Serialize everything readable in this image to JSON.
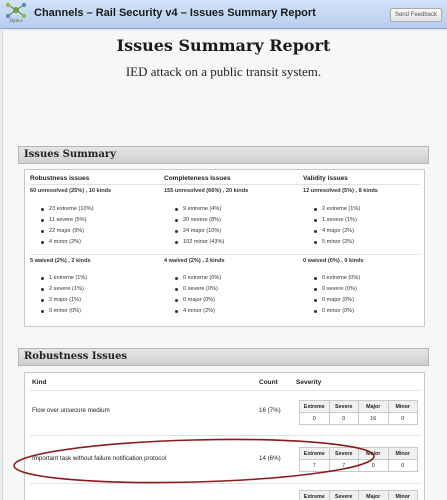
{
  "header": {
    "logo_text": "Hpie.e",
    "title": "Channels – Rail Security v4 – Issues Summary Report",
    "feedback_label": "Send Feedback"
  },
  "report": {
    "title": "Issues Summary Report",
    "subtitle": "IED attack on a public transit system."
  },
  "summary": {
    "heading": "Issues Summary",
    "columns": [
      {
        "header": "Robustness issues",
        "unresolved": "60 unresolved (25%) , 10 kinds",
        "unresolved_items": [
          "23 extreme (10%)",
          "11 severe (5%)",
          "22 major (9%)",
          "4 minor (2%)"
        ],
        "waived": "5 waived (2%) , 2 kinds",
        "waived_items": [
          "1 extreme (1%)",
          "2 severe (1%)",
          "2 major (1%)",
          "0 minor (0%)"
        ]
      },
      {
        "header": "Completeness Issues",
        "unresolved": "155 unresolved (66%) , 20 kinds",
        "unresolved_items": [
          "9 extreme (4%)",
          "20 severe (8%)",
          "24 major (10%)",
          "102 minor (43%)"
        ],
        "waived": "4 waived (2%) , 2 kinds",
        "waived_items": [
          "0 extreme (0%)",
          "0 severe (0%)",
          "0 major (0%)",
          "4 minor (2%)"
        ]
      },
      {
        "header": "Validity issues",
        "unresolved": "12 unresolved (5%) , 8 kinds",
        "unresolved_items": [
          "2 extreme (1%)",
          "1 severe (1%)",
          "4 major (2%)",
          "5 minor (2%)"
        ],
        "waived": "0 waived (0%) , 0 kinds",
        "waived_items": [
          "0 extreme (0%)",
          "0 severe (0%)",
          "0 major (0%)",
          "0 minor (0%)"
        ]
      }
    ]
  },
  "robustness": {
    "heading": "Robustness Issues",
    "col_kind": "Kind",
    "col_count": "Count",
    "col_severity": "Severity",
    "severity_labels": [
      "Extreme",
      "Severe",
      "Major",
      "Minor"
    ],
    "rows": [
      {
        "kind": "Flow over unsecure medium",
        "count": "16 (7%)",
        "values": [
          "0",
          "0",
          "16",
          "0"
        ]
      },
      {
        "kind": "Important task without failure notification protocol",
        "count": "14 (6%)",
        "values": [
          "7",
          "7",
          "0",
          "0"
        ]
      },
      {
        "kind": "",
        "count": "",
        "values": [
          "",
          "",
          "",
          ""
        ]
      }
    ]
  },
  "annotation": {
    "ellipse_color": "#8b1a1a"
  }
}
